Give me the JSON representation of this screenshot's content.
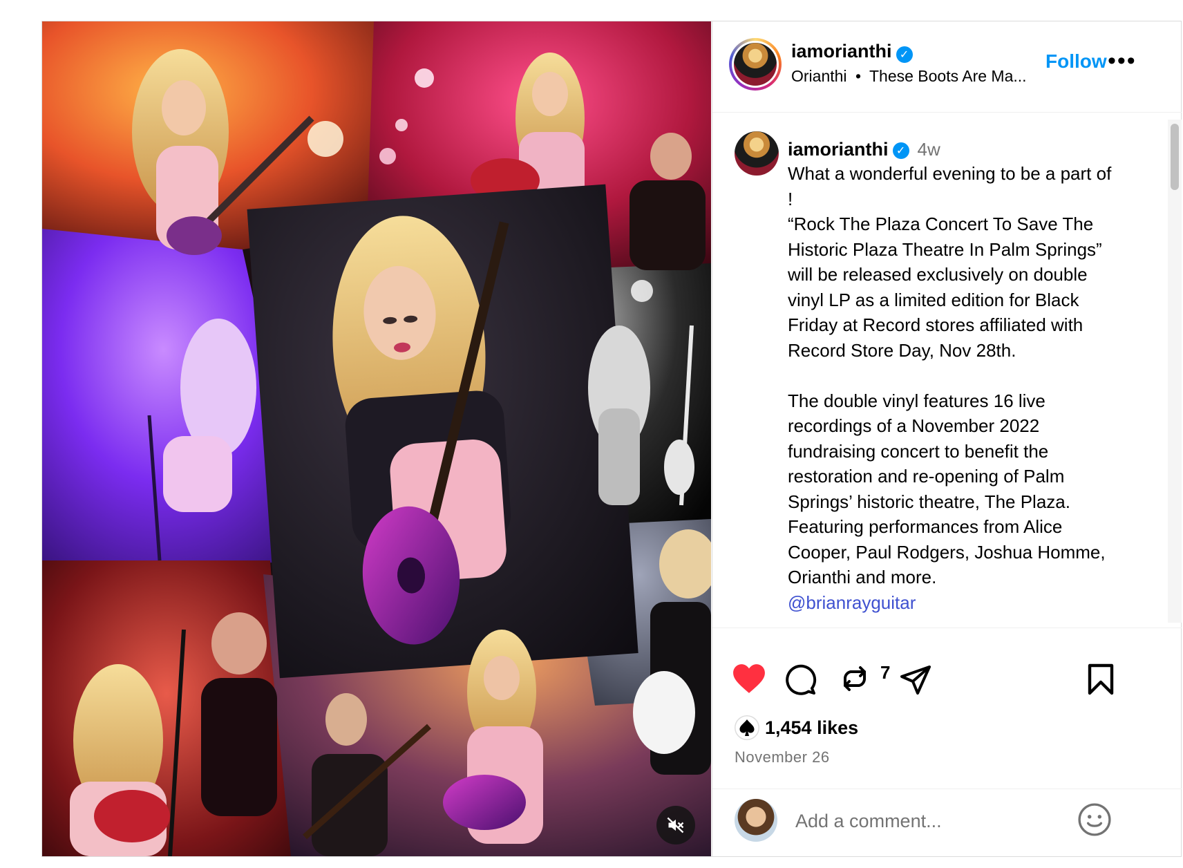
{
  "post": {
    "author": {
      "username": "iamorianthi",
      "verified": true,
      "subline_name": "Orianthi",
      "subline_separator": "•",
      "subline_audio": "These Boots Are Ma..."
    },
    "header": {
      "follow_label": "Follow",
      "more_label": "•••"
    },
    "caption": {
      "username": "iamorianthi",
      "time": "4w",
      "paragraph1": "What a wonderful evening to be a part of !\n“Rock The Plaza Concert To Save The Historic Plaza Theatre In Palm Springs” will be released exclusively on double vinyl LP as a limited edition for Black Friday at Record stores affiliated with Record Store Day, Nov 28th.",
      "paragraph2": "The double vinyl features 16 live recordings of a November 2022 fundraising concert to benefit the restoration and re-opening of Palm Springs’ historic theatre, The Plaza. Featuring performances from Alice Cooper, Paul Rodgers, Joshua Homme, Orianthi and more.",
      "mention": "@brianrayguitar"
    },
    "actions": {
      "liked": true,
      "repost_count": "7",
      "saved": false
    },
    "likes": {
      "text": "1,454 likes"
    },
    "date": "November 26",
    "comment": {
      "placeholder": "Add a comment..."
    },
    "media": {
      "muted": true
    },
    "colors": {
      "accent": "#0095f6",
      "like_red": "#ff3040",
      "mention": "#3f51d0",
      "muted_text": "#737373"
    },
    "icons": [
      "verified-icon",
      "more-icon",
      "heart-icon",
      "comment-icon",
      "repost-icon",
      "share-icon",
      "bookmark-icon",
      "emoji-icon",
      "mute-icon"
    ]
  }
}
